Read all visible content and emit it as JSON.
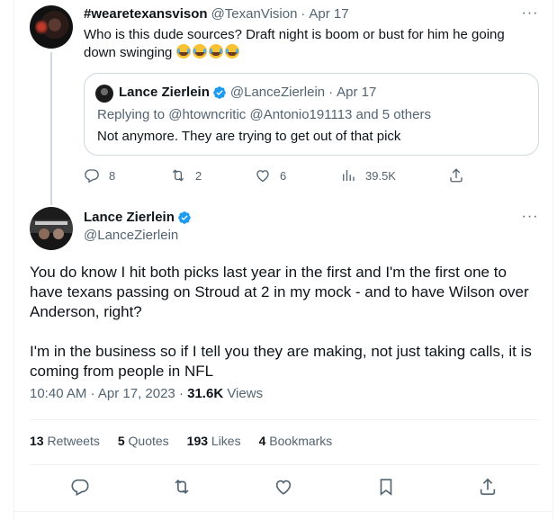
{
  "tweet1": {
    "display_name": "#wearetexansvison",
    "handle": "@TexanVision",
    "dot": "·",
    "date": "Apr 17",
    "text": "Who is this dude sources? Draft night is boom or bust for him he going down swinging",
    "more": "···",
    "quote": {
      "display_name": "Lance Zierlein",
      "handle": "@LanceZierlein",
      "dot": "·",
      "date": "Apr 17",
      "replying_to": "Replying to @htowncritic @Antonio191113 and 5 others",
      "text": "Not anymore. They are trying to get out of that pick"
    },
    "actions": {
      "replies": "8",
      "retweets": "2",
      "likes": "6",
      "views": "39.5K"
    }
  },
  "tweet2": {
    "display_name": "Lance Zierlein",
    "handle": "@LanceZierlein",
    "more": "···",
    "paragraph1": "You do know I hit both picks last year in the first and I'm the first one to have texans passing on Stroud at 2 in my mock - and to have Wilson over Anderson, right?",
    "paragraph2": "I'm in the business so if I tell you they are making, not just taking calls, it is coming from people in NFL",
    "time": "10:40 AM · Apr 17, 2023 ·",
    "views_count": "31.6K",
    "views_label": "Views",
    "stats": {
      "retweets_count": "13",
      "retweets_label": "Retweets",
      "quotes_count": "5",
      "quotes_label": "Quotes",
      "likes_count": "193",
      "likes_label": "Likes",
      "bookmarks_count": "4",
      "bookmarks_label": "Bookmarks"
    }
  },
  "colors": {
    "accent": "#1d9bf0",
    "muted": "#536471",
    "text": "#0f1419",
    "border": "#cfd9de"
  }
}
